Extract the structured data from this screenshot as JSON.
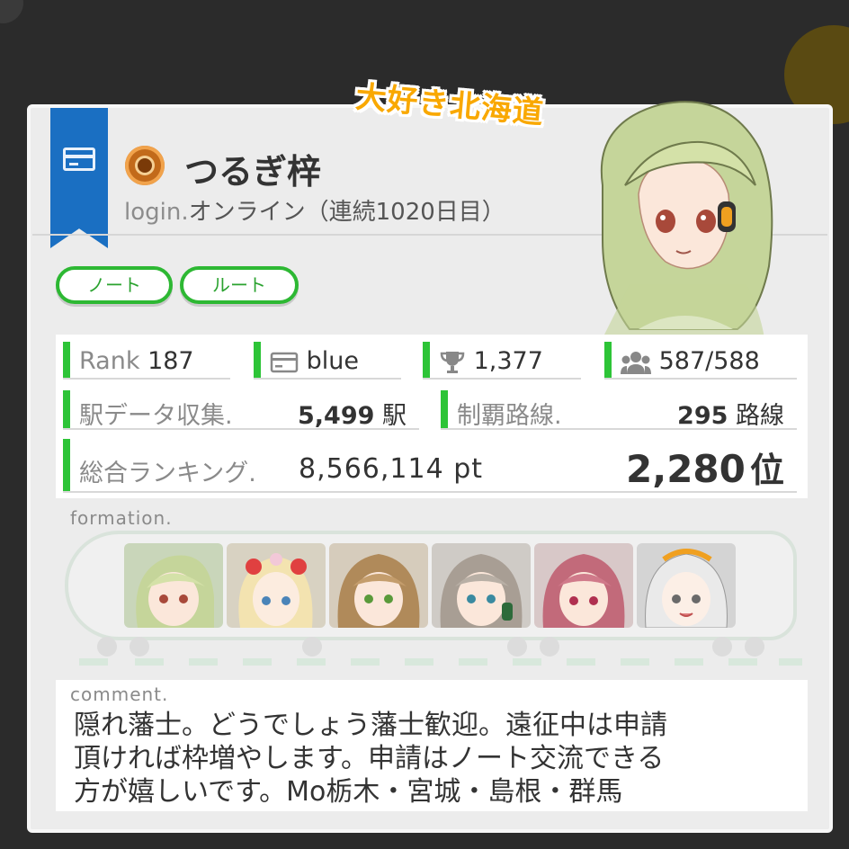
{
  "banner": "大好き北海道",
  "profile": {
    "name": "つるぎ梓",
    "login_label": "login.",
    "login_status": "オンライン（連続1020日目）"
  },
  "buttons": {
    "note": "ノート",
    "route": "ルート"
  },
  "stats": {
    "rank_label": "Rank",
    "rank_value": "187",
    "card": "blue",
    "trophies": "1,377",
    "members": "587/588",
    "stations_label": "駅データ収集.",
    "stations_value": "5,499",
    "stations_unit": "駅",
    "lines_label": "制覇路線.",
    "lines_value": "295",
    "lines_unit": "路線",
    "ranking_label": "総合ランキング.",
    "ranking_points": "8,566,114 pt",
    "ranking_position": "2,280",
    "ranking_unit": "位"
  },
  "formation_label": "formation.",
  "comment_label": "comment.",
  "comment_lines": [
    "隠れ藩士。どうでしょう藩士歓迎。遠征中は申請",
    "頂ければ枠増やします。申請はノート交流できる",
    "方が嬉しいです。Mo栃木・宮城・島根・群馬"
  ],
  "icons": {
    "ribbon": "card-icon",
    "coin": "coin-badge-icon",
    "card": "card-icon",
    "trophy": "trophy-icon",
    "members": "group-icon"
  },
  "colors": {
    "accent_green": "#2db833",
    "ribbon_blue": "#1a6fc2",
    "banner_yellow": "#f9a800"
  }
}
